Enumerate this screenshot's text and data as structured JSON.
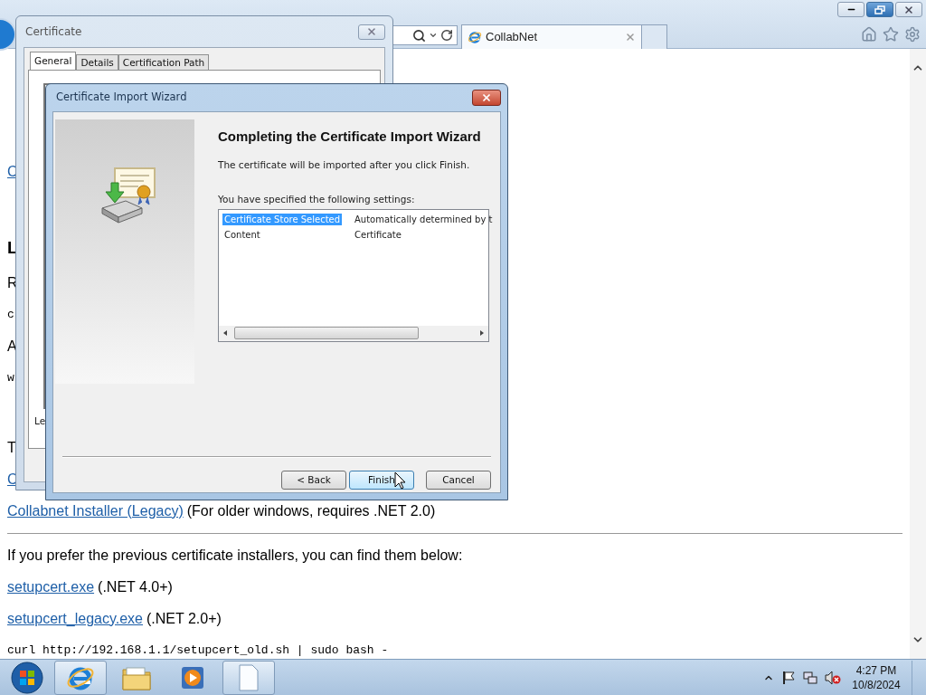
{
  "browser": {
    "tabs": [
      {
        "label": "CollabNet",
        "selected": true
      }
    ]
  },
  "page": {
    "lines": [
      {
        "kind": "heading1"
      },
      {
        "kind": "heading2"
      },
      {
        "kind": "link",
        "text": "C"
      },
      {
        "kind": "heading2"
      },
      {
        "kind": "heading3",
        "text": "L"
      },
      {
        "kind": "text",
        "text": "R"
      },
      {
        "kind": "code",
        "text": "c"
      },
      {
        "kind": "text",
        "text": "A"
      },
      {
        "kind": "code",
        "text": "w"
      },
      {
        "kind": "heading3"
      },
      {
        "kind": "text",
        "text": "T"
      },
      {
        "kind": "link",
        "text": "C"
      },
      {
        "kind": "link",
        "text": "Collabnet Installer (Legacy)",
        "note": "(For older windows, requires .NET 2.0)"
      },
      {
        "kind": "rule"
      },
      {
        "kind": "text",
        "text": "If you prefer the previous certificate installers, you can find them below:"
      },
      {
        "kind": "link",
        "text": "setupcert.exe",
        "note": "(.NET 4.0+)"
      },
      {
        "kind": "link",
        "text": "setupcert_legacy.exe",
        "note": "(.NET 2.0+)"
      },
      {
        "kind": "code",
        "text": "curl http://192.168.1.1/setupcert_old.sh | sudo bash -"
      }
    ]
  },
  "certificate_dialog": {
    "title": "Certificate",
    "tabs": [
      {
        "label": "General",
        "selected": true
      },
      {
        "label": "Details",
        "selected": false
      },
      {
        "label": "Certification Path",
        "selected": false
      }
    ],
    "fragment": "Le"
  },
  "wizard": {
    "title": "Certificate Import Wizard",
    "heading": "Completing the Certificate Import Wizard",
    "intro": "The certificate will be imported after you click Finish.",
    "settings_label": "You have specified the following settings:",
    "settings": [
      {
        "name": "Certificate Store Selected",
        "value": "Automatically determined by t",
        "selected": true
      },
      {
        "name": "Content",
        "value": "Certificate",
        "selected": false
      }
    ],
    "buttons": [
      {
        "label": "< Back",
        "default": false
      },
      {
        "label": "Finish",
        "default": true
      },
      {
        "label": "Cancel",
        "default": false
      }
    ]
  },
  "taskbar": {
    "apps": [
      {
        "kind": "browser",
        "active": true
      },
      {
        "kind": "folder",
        "active": false
      },
      {
        "kind": "media",
        "active": false
      },
      {
        "kind": "document",
        "active": true
      }
    ],
    "time": "4:27 PM",
    "date": "10/8/2024"
  }
}
